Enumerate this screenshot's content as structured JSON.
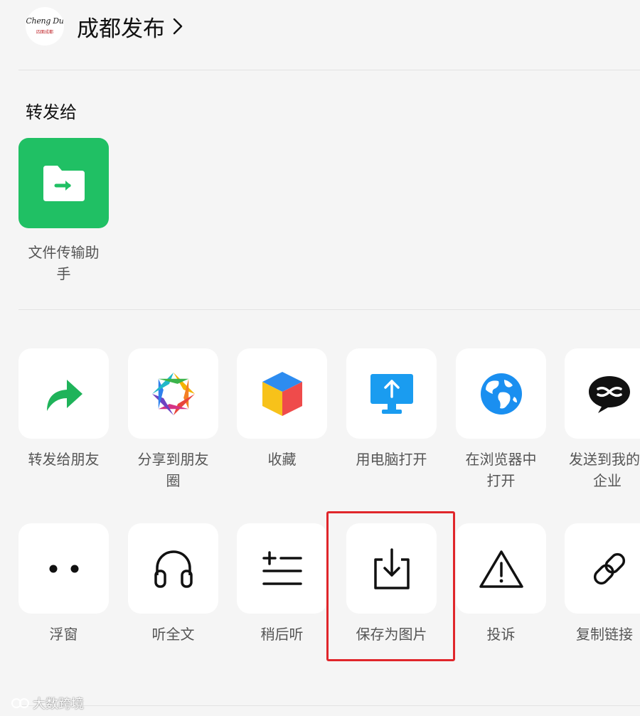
{
  "header": {
    "avatar_logo": "Cheng Du",
    "avatar_sub": "四面成都",
    "title": "成都发布"
  },
  "forward": {
    "section_label": "转发给",
    "contact_name_line1": "文件传输助",
    "contact_name_line2": "手"
  },
  "actions_row1": [
    {
      "line1": "转发给朋友",
      "line2": "",
      "icon": "forward-arrow-icon"
    },
    {
      "line1": "分享到朋友",
      "line2": "圈",
      "icon": "moments-aperture-icon"
    },
    {
      "line1": "收藏",
      "line2": "",
      "icon": "favorites-cube-icon"
    },
    {
      "line1": "用电脑打开",
      "line2": "",
      "icon": "open-on-pc-icon"
    },
    {
      "line1": "在浏览器中",
      "line2": "打开",
      "icon": "globe-icon"
    },
    {
      "line1": "发送到我的",
      "line2": "企业",
      "icon": "wecom-chat-icon"
    }
  ],
  "actions_row2": [
    {
      "line1": "浮窗",
      "icon": "float-window-icon"
    },
    {
      "line1": "听全文",
      "icon": "headphones-icon"
    },
    {
      "line1": "稍后听",
      "icon": "listen-later-icon"
    },
    {
      "line1": "保存为图片",
      "icon": "save-download-icon"
    },
    {
      "line1": "投诉",
      "icon": "warning-icon"
    },
    {
      "line1": "复制链接",
      "icon": "link-icon"
    }
  ],
  "watermark": {
    "text": "大数跨境"
  },
  "colors": {
    "background": "#f5f5f5",
    "wechat_green": "#20c064",
    "highlight_red": "#e0262b",
    "label_gray": "#555555"
  }
}
